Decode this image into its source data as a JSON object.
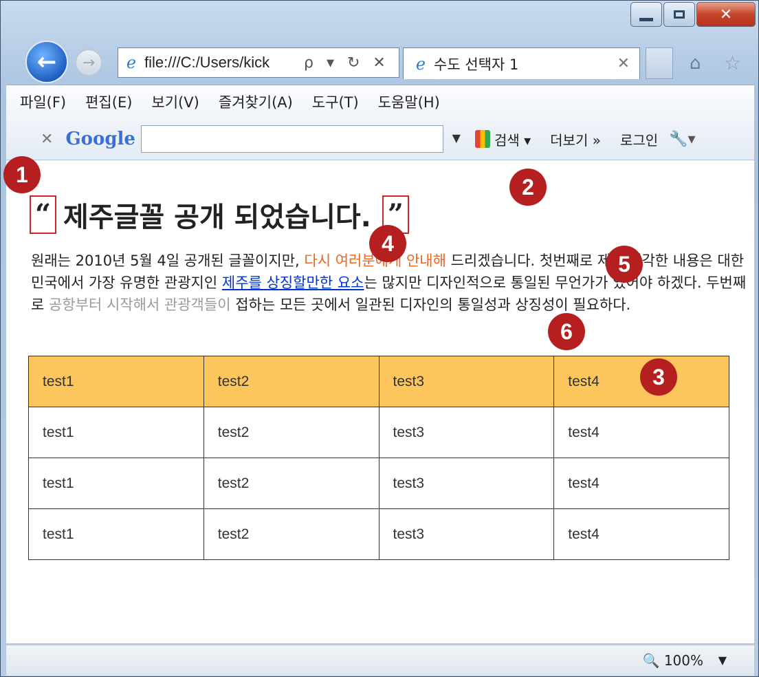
{
  "browser": {
    "address_url": "file:///C:/Users/kick",
    "address_buttons": "ρ ▾ ↻ ✕",
    "tab_title": "수도 선택자 1",
    "menu": [
      "파일(F)",
      "편집(E)",
      "보기(V)",
      "즐겨찾기(A)",
      "도구(T)",
      "도움말(H)"
    ],
    "google_bar": {
      "logo": "Google",
      "search_label": "검색 ▾",
      "more_label": "더보기 »",
      "login_label": "로그인"
    },
    "zoom": "100%"
  },
  "page": {
    "open_quote": "“",
    "heading": "제주글꼴 공개 되었습니다.",
    "close_quote": "”",
    "para": {
      "p1": "원래는 2010년 5월 4일 공개된 글꼴이지만, ",
      "p2_orange": "다시 여러분에게 안내해",
      "p3": " 드리겠습니다. 첫번째로 제가 생각한 내용은 대한민국에서 가장 유명한 관광지인 ",
      "p4_link": "제주를 상징할만한 요소",
      "p5": "는 많지만 디자인적으로 통일된 무언가가 있어야 하겠다. 두번째로 ",
      "p6_gray": "공항부터 시작해서 관광객들이",
      "p7": " 접하는 모든 곳에서 일관된 디자인의 통일성과 상징성이 필요하다."
    },
    "table": [
      [
        "test1",
        "test2",
        "test3",
        "test4"
      ],
      [
        "test1",
        "test2",
        "test3",
        "test4"
      ],
      [
        "test1",
        "test2",
        "test3",
        "test4"
      ],
      [
        "test1",
        "test2",
        "test3",
        "test4"
      ]
    ]
  },
  "annotations": [
    "1",
    "2",
    "3",
    "4",
    "5",
    "6"
  ],
  "colors": {
    "badge": "#b51f1f",
    "table_header": "#fcc65c",
    "orange_text": "#f0641e",
    "link": "#0033cc"
  }
}
